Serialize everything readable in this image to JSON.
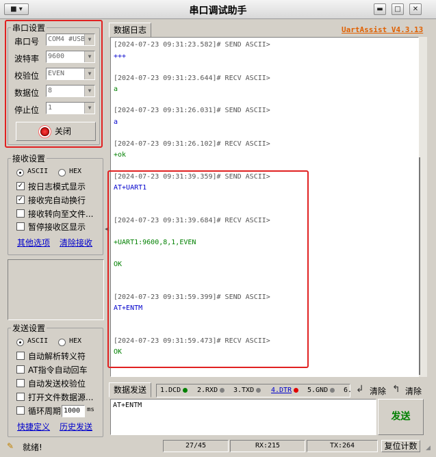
{
  "window": {
    "title": "串口调试助手",
    "brand": "UartAssist V4.3.13"
  },
  "port_settings": {
    "legend": "串口设置",
    "fields": [
      {
        "label": "串口号",
        "value": "COM4 #USB"
      },
      {
        "label": "波特率",
        "value": "9600"
      },
      {
        "label": "校验位",
        "value": "EVEN"
      },
      {
        "label": "数据位",
        "value": "8"
      },
      {
        "label": "停止位",
        "value": "1"
      }
    ],
    "close_button": "关闭"
  },
  "receive_settings": {
    "legend": "接收设置",
    "ascii": "ASCII",
    "hex": "HEX",
    "options": [
      "按日志模式显示",
      "接收完自动换行",
      "接收转向至文件...",
      "暂停接收区显示"
    ],
    "options_checked": [
      true,
      true,
      false,
      false
    ],
    "link_more": "其他选项",
    "link_clear": "清除接收"
  },
  "send_settings": {
    "legend": "发送设置",
    "ascii": "ASCII",
    "hex": "HEX",
    "options": [
      "自动解析转义符",
      "AT指令自动回车",
      "自动发送校验位",
      "打开文件数据源...",
      "循环周期"
    ],
    "period_value": "1000",
    "period_unit": "ms",
    "link_shortcut": "快捷定义",
    "link_history": "历史发送"
  },
  "log": {
    "tab": "数据日志",
    "entries": [
      {
        "header": "[2024-07-23 09:31:23.582]# SEND ASCII>",
        "lines": [
          "+++"
        ],
        "kind": "send"
      },
      {
        "header": "[2024-07-23 09:31:23.644]# RECV ASCII>",
        "lines": [
          "a"
        ],
        "kind": "recv"
      },
      {
        "header": "[2024-07-23 09:31:26.031]# SEND ASCII>",
        "lines": [
          "a"
        ],
        "kind": "send"
      },
      {
        "header": "[2024-07-23 09:31:26.102]# RECV ASCII>",
        "lines": [
          "+ok"
        ],
        "kind": "recv"
      },
      {
        "header": "[2024-07-23 09:31:39.359]# SEND ASCII>",
        "lines": [
          "AT+UART1"
        ],
        "kind": "send"
      },
      {
        "header": "[2024-07-23 09:31:39.684]# RECV ASCII>",
        "lines": [
          "+UART1:9600,8,1,EVEN",
          "OK"
        ],
        "kind": "recv"
      },
      {
        "header": "[2024-07-23 09:31:59.399]# SEND ASCII>",
        "lines": [
          "AT+ENTM"
        ],
        "kind": "send"
      },
      {
        "header": "[2024-07-23 09:31:59.473]# RECV ASCII>",
        "lines": [
          "OK"
        ],
        "kind": "recv"
      }
    ]
  },
  "send_bar": {
    "tab": "数据发送",
    "channels": [
      {
        "label": "1.DCD",
        "color": "#008000"
      },
      {
        "label": "2.RXD",
        "color": "#808080"
      },
      {
        "label": "3.TXD",
        "color": "#808080"
      },
      {
        "label": "4.DTR",
        "color": "#e00000"
      },
      {
        "label": "5.GND",
        "color": "#808080"
      },
      {
        "label": "6.",
        "color": ""
      }
    ],
    "clear1": "清除",
    "clear2": "清除",
    "input_text": "AT+ENTM",
    "send_button": "发送"
  },
  "status": {
    "text": "就绪!",
    "progress": "27/45",
    "rx": "RX:215",
    "tx": "TX:264",
    "reset_button": "复位计数"
  }
}
